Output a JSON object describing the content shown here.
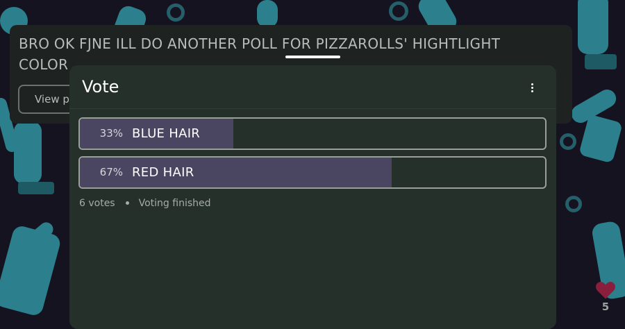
{
  "post": {
    "title": "BRO OK FJNE ILL DO ANOTHER POLL FOR PIZZAROLLS' HIGHTLIGHT COLOR",
    "view_button_label": "View p"
  },
  "poll": {
    "title": "Vote",
    "options": [
      {
        "percent_label": "33%",
        "label": "BLUE HAIR",
        "share": 0.33
      },
      {
        "percent_label": "67%",
        "label": "RED HAIR",
        "share": 0.67
      }
    ],
    "votes_label": "6 votes",
    "status_label": "Voting finished"
  },
  "like": {
    "count": "5",
    "color": "#8a1f3d"
  },
  "colors": {
    "panel": "#26302b",
    "bar_fill": "#4a4560",
    "background": "#15131f",
    "tube": "#2c7f8c"
  }
}
